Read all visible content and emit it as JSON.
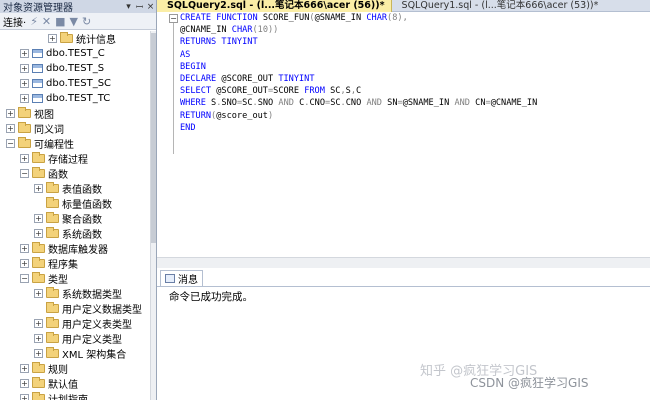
{
  "explorer": {
    "title": "对象资源管理器",
    "pin": "▾ ╡",
    "close": "×",
    "toolbar": {
      "connect": "连接·"
    },
    "tree": [
      {
        "label": "统计信息",
        "kind": "folder",
        "indent": 2
      },
      {
        "label": "dbo.TEST_C",
        "kind": "table",
        "indent": 0
      },
      {
        "label": "dbo.TEST_S",
        "kind": "table",
        "indent": 0
      },
      {
        "label": "dbo.TEST_SC",
        "kind": "table",
        "indent": 0
      },
      {
        "label": "dbo.TEST_TC",
        "kind": "table",
        "indent": 0
      },
      {
        "label": "视图",
        "kind": "folder",
        "indent": -1
      },
      {
        "label": "同义词",
        "kind": "folder",
        "indent": -1
      },
      {
        "label": "可编程性",
        "kind": "folder",
        "indent": -1,
        "expanded": true
      },
      {
        "label": "存储过程",
        "kind": "folder",
        "indent": 0
      },
      {
        "label": "函数",
        "kind": "folder",
        "indent": 0,
        "expanded": true
      },
      {
        "label": "表值函数",
        "kind": "folder",
        "indent": 1
      },
      {
        "label": "标量值函数",
        "kind": "folder",
        "indent": 1,
        "leaf": true
      },
      {
        "label": "聚合函数",
        "kind": "folder",
        "indent": 1
      },
      {
        "label": "系统函数",
        "kind": "folder",
        "indent": 1
      },
      {
        "label": "数据库触发器",
        "kind": "folder",
        "indent": 0
      },
      {
        "label": "程序集",
        "kind": "folder",
        "indent": 0
      },
      {
        "label": "类型",
        "kind": "folder",
        "indent": 0,
        "expanded": true
      },
      {
        "label": "系统数据类型",
        "kind": "folder",
        "indent": 1
      },
      {
        "label": "用户定义数据类型",
        "kind": "folder",
        "indent": 1,
        "leaf": true
      },
      {
        "label": "用户定义表类型",
        "kind": "folder",
        "indent": 1
      },
      {
        "label": "用户定义类型",
        "kind": "folder",
        "indent": 1
      },
      {
        "label": "XML 架构集合",
        "kind": "folder",
        "indent": 1
      },
      {
        "label": "规则",
        "kind": "folder",
        "indent": 0
      },
      {
        "label": "默认值",
        "kind": "folder",
        "indent": 0
      },
      {
        "label": "计划指南",
        "kind": "folder",
        "indent": 0
      }
    ]
  },
  "tabs": [
    {
      "label": "SQLQuery2.sql - (l...笔记本666\\acer (56))*",
      "active": true
    },
    {
      "label": "SQLQuery1.sql - (l...笔记本666\\acer (53))*",
      "active": false
    }
  ],
  "code_lines": [
    [
      [
        "kw",
        "CREATE"
      ],
      [
        "idn",
        " "
      ],
      [
        "kw",
        "FUNCTION"
      ],
      [
        "idn",
        " SCORE_FUN"
      ],
      [
        "gray",
        "("
      ],
      [
        "vr",
        "@SNAME_IN"
      ],
      [
        "idn",
        " "
      ],
      [
        "kw",
        "CHAR"
      ],
      [
        "gray",
        "(8),"
      ]
    ],
    [
      [
        "vr",
        "@CNAME_IN"
      ],
      [
        "idn",
        " "
      ],
      [
        "kw",
        "CHAR"
      ],
      [
        "gray",
        "(10))"
      ]
    ],
    [
      [
        "kw",
        "RETURNS"
      ],
      [
        "idn",
        " "
      ],
      [
        "kw",
        "TINYINT"
      ]
    ],
    [
      [
        "kw",
        "AS"
      ]
    ],
    [
      [
        "kw",
        "BEGIN"
      ]
    ],
    [
      [
        "kw",
        "DECLARE"
      ],
      [
        "idn",
        " @SCORE_OUT "
      ],
      [
        "kw",
        "TINYINT"
      ]
    ],
    [
      [
        "kw",
        "SELECT"
      ],
      [
        "idn",
        " @SCORE_OUT"
      ],
      [
        "gray",
        "="
      ],
      [
        "idn",
        "SCORE "
      ],
      [
        "kw",
        "FROM"
      ],
      [
        "idn",
        " SC"
      ],
      [
        "gray",
        ","
      ],
      [
        "idn",
        "S"
      ],
      [
        "gray",
        ","
      ],
      [
        "idn",
        "C"
      ]
    ],
    [
      [
        "kw",
        "WHERE"
      ],
      [
        "idn",
        " S"
      ],
      [
        "gray",
        "."
      ],
      [
        "idn",
        "SNO"
      ],
      [
        "gray",
        "="
      ],
      [
        "idn",
        "SC"
      ],
      [
        "gray",
        "."
      ],
      [
        "idn",
        "SNO "
      ],
      [
        "gray",
        "AND"
      ],
      [
        "idn",
        " C"
      ],
      [
        "gray",
        "."
      ],
      [
        "idn",
        "CNO"
      ],
      [
        "gray",
        "="
      ],
      [
        "idn",
        "SC"
      ],
      [
        "gray",
        "."
      ],
      [
        "idn",
        "CNO "
      ],
      [
        "gray",
        "AND"
      ],
      [
        "idn",
        " SN"
      ],
      [
        "gray",
        "="
      ],
      [
        "idn",
        "@SNAME_IN "
      ],
      [
        "gray",
        "AND"
      ],
      [
        "idn",
        " CN"
      ],
      [
        "gray",
        "="
      ],
      [
        "idn",
        "@CNAME_IN"
      ]
    ],
    [
      [
        "kw",
        "RETURN"
      ],
      [
        "gray",
        "("
      ],
      [
        "idn",
        "@score_out"
      ],
      [
        "gray",
        ")"
      ]
    ],
    [
      [
        "kw",
        "END"
      ]
    ]
  ],
  "messages": {
    "tab_label": "消息",
    "text": "命令已成功完成。"
  },
  "watermark": {
    "zhihu": "知乎 @疯狂学习GIS",
    "csdn": "CSDN @疯狂学习GIS"
  }
}
